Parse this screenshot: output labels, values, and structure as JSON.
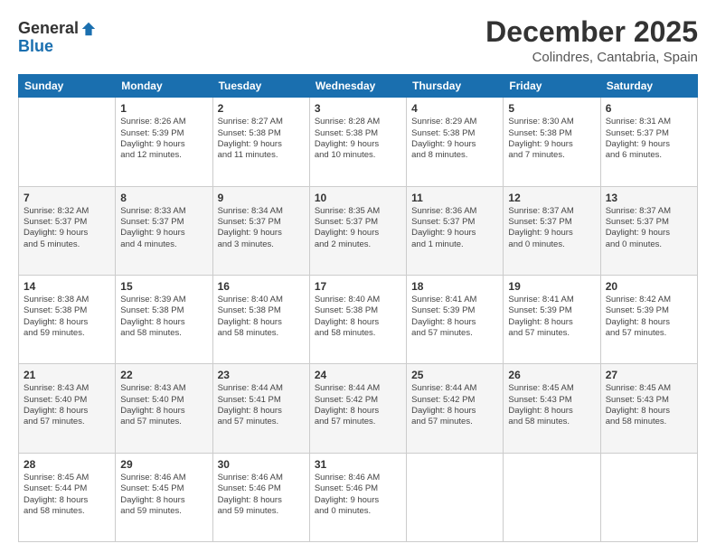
{
  "header": {
    "logo_line1": "General",
    "logo_line2": "Blue",
    "main_title": "December 2025",
    "subtitle": "Colindres, Cantabria, Spain"
  },
  "calendar": {
    "headers": [
      "Sunday",
      "Monday",
      "Tuesday",
      "Wednesday",
      "Thursday",
      "Friday",
      "Saturday"
    ],
    "rows": [
      [
        {
          "day": "",
          "info": ""
        },
        {
          "day": "1",
          "info": "Sunrise: 8:26 AM\nSunset: 5:39 PM\nDaylight: 9 hours\nand 12 minutes."
        },
        {
          "day": "2",
          "info": "Sunrise: 8:27 AM\nSunset: 5:38 PM\nDaylight: 9 hours\nand 11 minutes."
        },
        {
          "day": "3",
          "info": "Sunrise: 8:28 AM\nSunset: 5:38 PM\nDaylight: 9 hours\nand 10 minutes."
        },
        {
          "day": "4",
          "info": "Sunrise: 8:29 AM\nSunset: 5:38 PM\nDaylight: 9 hours\nand 8 minutes."
        },
        {
          "day": "5",
          "info": "Sunrise: 8:30 AM\nSunset: 5:38 PM\nDaylight: 9 hours\nand 7 minutes."
        },
        {
          "day": "6",
          "info": "Sunrise: 8:31 AM\nSunset: 5:37 PM\nDaylight: 9 hours\nand 6 minutes."
        }
      ],
      [
        {
          "day": "7",
          "info": "Sunrise: 8:32 AM\nSunset: 5:37 PM\nDaylight: 9 hours\nand 5 minutes."
        },
        {
          "day": "8",
          "info": "Sunrise: 8:33 AM\nSunset: 5:37 PM\nDaylight: 9 hours\nand 4 minutes."
        },
        {
          "day": "9",
          "info": "Sunrise: 8:34 AM\nSunset: 5:37 PM\nDaylight: 9 hours\nand 3 minutes."
        },
        {
          "day": "10",
          "info": "Sunrise: 8:35 AM\nSunset: 5:37 PM\nDaylight: 9 hours\nand 2 minutes."
        },
        {
          "day": "11",
          "info": "Sunrise: 8:36 AM\nSunset: 5:37 PM\nDaylight: 9 hours\nand 1 minute."
        },
        {
          "day": "12",
          "info": "Sunrise: 8:37 AM\nSunset: 5:37 PM\nDaylight: 9 hours\nand 0 minutes."
        },
        {
          "day": "13",
          "info": "Sunrise: 8:37 AM\nSunset: 5:37 PM\nDaylight: 9 hours\nand 0 minutes."
        }
      ],
      [
        {
          "day": "14",
          "info": "Sunrise: 8:38 AM\nSunset: 5:38 PM\nDaylight: 8 hours\nand 59 minutes."
        },
        {
          "day": "15",
          "info": "Sunrise: 8:39 AM\nSunset: 5:38 PM\nDaylight: 8 hours\nand 58 minutes."
        },
        {
          "day": "16",
          "info": "Sunrise: 8:40 AM\nSunset: 5:38 PM\nDaylight: 8 hours\nand 58 minutes."
        },
        {
          "day": "17",
          "info": "Sunrise: 8:40 AM\nSunset: 5:38 PM\nDaylight: 8 hours\nand 58 minutes."
        },
        {
          "day": "18",
          "info": "Sunrise: 8:41 AM\nSunset: 5:39 PM\nDaylight: 8 hours\nand 57 minutes."
        },
        {
          "day": "19",
          "info": "Sunrise: 8:41 AM\nSunset: 5:39 PM\nDaylight: 8 hours\nand 57 minutes."
        },
        {
          "day": "20",
          "info": "Sunrise: 8:42 AM\nSunset: 5:39 PM\nDaylight: 8 hours\nand 57 minutes."
        }
      ],
      [
        {
          "day": "21",
          "info": "Sunrise: 8:43 AM\nSunset: 5:40 PM\nDaylight: 8 hours\nand 57 minutes."
        },
        {
          "day": "22",
          "info": "Sunrise: 8:43 AM\nSunset: 5:40 PM\nDaylight: 8 hours\nand 57 minutes."
        },
        {
          "day": "23",
          "info": "Sunrise: 8:44 AM\nSunset: 5:41 PM\nDaylight: 8 hours\nand 57 minutes."
        },
        {
          "day": "24",
          "info": "Sunrise: 8:44 AM\nSunset: 5:42 PM\nDaylight: 8 hours\nand 57 minutes."
        },
        {
          "day": "25",
          "info": "Sunrise: 8:44 AM\nSunset: 5:42 PM\nDaylight: 8 hours\nand 57 minutes."
        },
        {
          "day": "26",
          "info": "Sunrise: 8:45 AM\nSunset: 5:43 PM\nDaylight: 8 hours\nand 58 minutes."
        },
        {
          "day": "27",
          "info": "Sunrise: 8:45 AM\nSunset: 5:43 PM\nDaylight: 8 hours\nand 58 minutes."
        }
      ],
      [
        {
          "day": "28",
          "info": "Sunrise: 8:45 AM\nSunset: 5:44 PM\nDaylight: 8 hours\nand 58 minutes."
        },
        {
          "day": "29",
          "info": "Sunrise: 8:46 AM\nSunset: 5:45 PM\nDaylight: 8 hours\nand 59 minutes."
        },
        {
          "day": "30",
          "info": "Sunrise: 8:46 AM\nSunset: 5:46 PM\nDaylight: 8 hours\nand 59 minutes."
        },
        {
          "day": "31",
          "info": "Sunrise: 8:46 AM\nSunset: 5:46 PM\nDaylight: 9 hours\nand 0 minutes."
        },
        {
          "day": "",
          "info": ""
        },
        {
          "day": "",
          "info": ""
        },
        {
          "day": "",
          "info": ""
        }
      ]
    ]
  }
}
